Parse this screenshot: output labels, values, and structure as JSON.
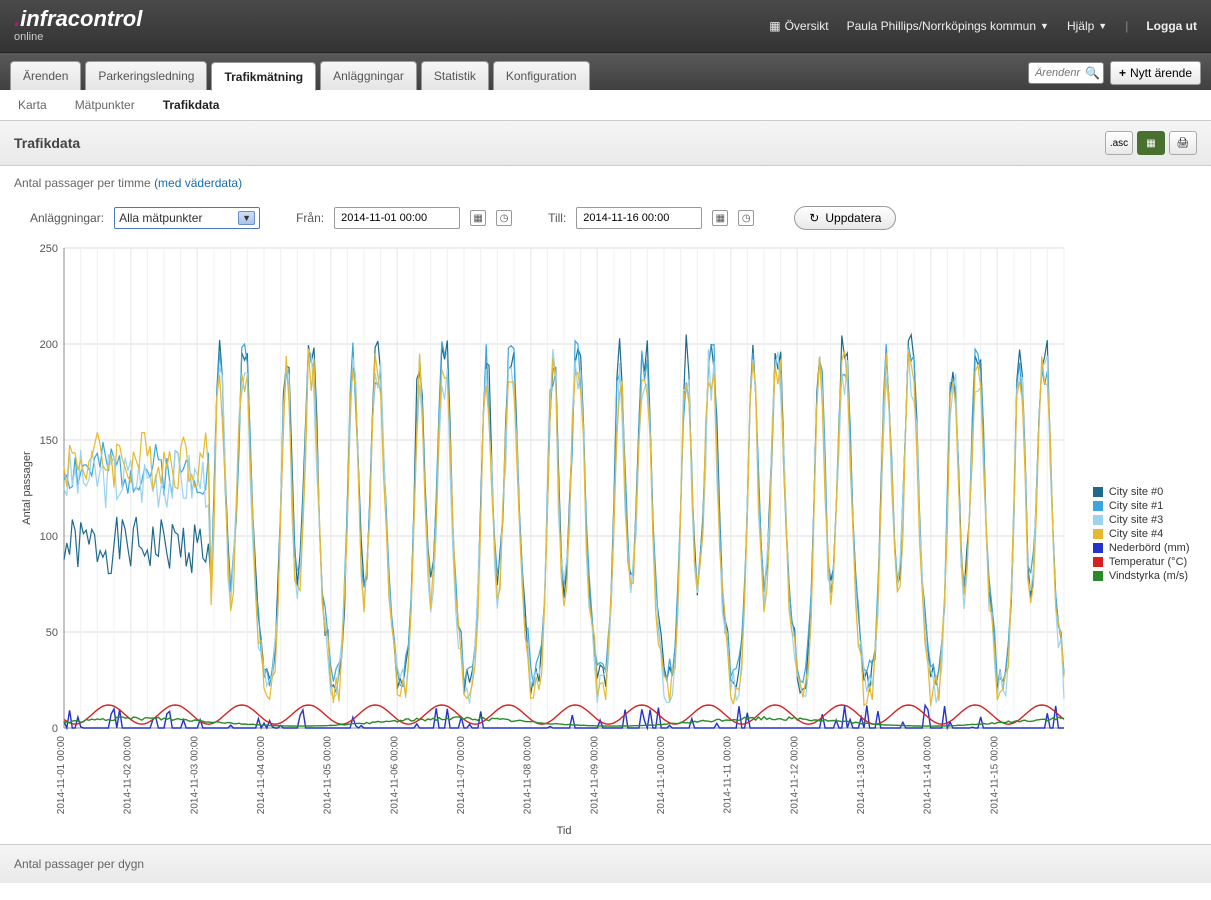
{
  "brand": {
    "name": "infracontrol",
    "sub": "online"
  },
  "topbar": {
    "overview": "Översikt",
    "user": "Paula Phillips/Norrköpings kommun",
    "help": "Hjälp",
    "logout": "Logga ut"
  },
  "tabs": [
    "Ärenden",
    "Parkeringsledning",
    "Trafikmätning",
    "Anläggningar",
    "Statistik",
    "Konfiguration"
  ],
  "tabs_active": 2,
  "search_placeholder": "Ärendenr",
  "new_case": "Nytt ärende",
  "subtabs": [
    "Karta",
    "Mätpunkter",
    "Trafikdata"
  ],
  "subtabs_active": 2,
  "page_title": "Trafikdata",
  "export_btn": ".asc",
  "subtitle_text": "Antal passager per timme ",
  "subtitle_link": "(med väderdata)",
  "controls": {
    "facilities_label": "Anläggningar:",
    "facilities_value": "Alla mätpunkter",
    "from_label": "Från:",
    "from_value": "2014-11-01 00:00",
    "to_label": "Till:",
    "to_value": "2014-11-16 00:00",
    "update": "Uppdatera"
  },
  "footer": "Antal passager per dygn",
  "chart_data": {
    "type": "line",
    "xlabel": "Tid",
    "ylabel": "Antal passager",
    "ylim": [
      0,
      250
    ],
    "yticks": [
      0,
      50,
      100,
      150,
      200,
      250
    ],
    "x_categories": [
      "2014-11-01 00:00",
      "2014-11-02 00:00",
      "2014-11-03 00:00",
      "2014-11-04 00:00",
      "2014-11-05 00:00",
      "2014-11-06 00:00",
      "2014-11-07 00:00",
      "2014-11-08 00:00",
      "2014-11-09 00:00",
      "2014-11-10 00:00",
      "2014-11-11 00:00",
      "2014-11-12 00:00",
      "2014-11-13 00:00",
      "2014-11-14 00:00",
      "2014-11-15 00:00"
    ],
    "series": [
      {
        "name": "City site #0",
        "color": "#1f6a8b",
        "phase1": {
          "level": 95,
          "noise": 15,
          "until": 2.2
        },
        "phase2": {
          "low": 25,
          "high": 195,
          "hi_noise": 10,
          "lo_noise": 8
        }
      },
      {
        "name": "City site #1",
        "color": "#3aa6dd",
        "phase1": {
          "level": 135,
          "noise": 14,
          "until": 2.2
        },
        "phase2": {
          "low": 28,
          "high": 190,
          "hi_noise": 12,
          "lo_noise": 8
        }
      },
      {
        "name": "City site #3",
        "color": "#9bd3ef",
        "phase1": {
          "level": 130,
          "noise": 16,
          "until": 2.2
        },
        "phase2": {
          "low": 22,
          "high": 185,
          "hi_noise": 15,
          "lo_noise": 10
        }
      },
      {
        "name": "City site #4",
        "color": "#e6b92e",
        "phase1": {
          "level": 140,
          "noise": 16,
          "until": 2.2
        },
        "phase2": {
          "low": 20,
          "high": 185,
          "hi_noise": 12,
          "lo_noise": 9
        }
      },
      {
        "name": "Nederbörd (mm)",
        "color": "#2233cc",
        "kind": "precip",
        "max": 12
      },
      {
        "name": "Temperatur (°C)",
        "color": "#d62020",
        "kind": "temp",
        "low": 2,
        "high": 12
      },
      {
        "name": "Vindstyrka (m/s)",
        "color": "#2a8a2a",
        "kind": "wind",
        "low": 1,
        "high": 6
      }
    ]
  }
}
